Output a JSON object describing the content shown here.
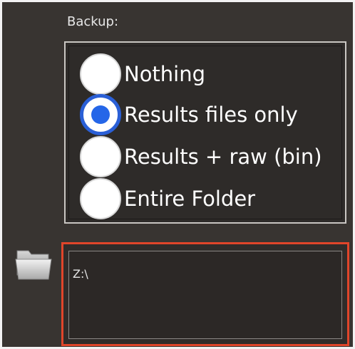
{
  "backup": {
    "label": "Backup:",
    "options": [
      {
        "label": "Nothing",
        "selected": false
      },
      {
        "label": "Results files only",
        "selected": true
      },
      {
        "label": "Results + raw (bin)",
        "selected": false
      },
      {
        "label": "Entire Folder",
        "selected": false
      }
    ]
  },
  "folder": {
    "icon": "folder-icon",
    "path_value": "Z:\\"
  },
  "colors": {
    "background": "#383431",
    "radio_selected": "#2566e8",
    "highlight_border": "#e0452a"
  }
}
